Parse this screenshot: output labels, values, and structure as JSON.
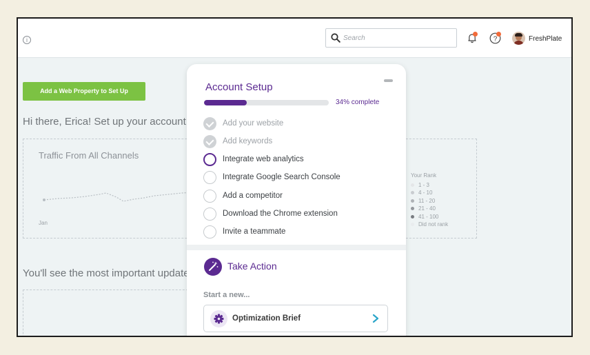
{
  "header": {
    "search_placeholder": "Search",
    "user_name": "FreshPlate"
  },
  "main": {
    "cta_label": "Add a Web Property to Set Up",
    "greeting": "Hi there, Erica! Set up your account to g",
    "traffic_panel": {
      "title": "Traffic From All Channels",
      "x_label": "Jan"
    },
    "rank_legend": {
      "title": "Your Rank",
      "items": [
        {
          "label": "1 - 3",
          "color": "#e4e6e8"
        },
        {
          "label": "4 - 10",
          "color": "#c9ccd0"
        },
        {
          "label": "11 - 20",
          "color": "#aeb2b6"
        },
        {
          "label": "21 - 40",
          "color": "#93979c"
        },
        {
          "label": "41 - 100",
          "color": "#787c81"
        },
        {
          "label": "Did not rank",
          "color": "#e9ecee"
        }
      ]
    },
    "updates_text": "You'll see the most important updates l"
  },
  "setup_card": {
    "title": "Account Setup",
    "progress_percent": 34,
    "progress_label": "34% complete",
    "steps": [
      {
        "label": "Add your website",
        "state": "done"
      },
      {
        "label": "Add keywords",
        "state": "done"
      },
      {
        "label": "Integrate web analytics",
        "state": "active"
      },
      {
        "label": "Integrate Google Search Console",
        "state": "todo"
      },
      {
        "label": "Add a competitor",
        "state": "todo"
      },
      {
        "label": "Download the Chrome extension",
        "state": "todo"
      },
      {
        "label": "Invite a teammate",
        "state": "todo"
      }
    ],
    "take_action_title": "Take Action",
    "start_new_label": "Start a new...",
    "brief_label": "Optimization Brief"
  },
  "colors": {
    "accent": "#5b2a91",
    "cta_green": "#7cc243",
    "notification": "#f26b3a",
    "chevron": "#2aa5c9"
  }
}
